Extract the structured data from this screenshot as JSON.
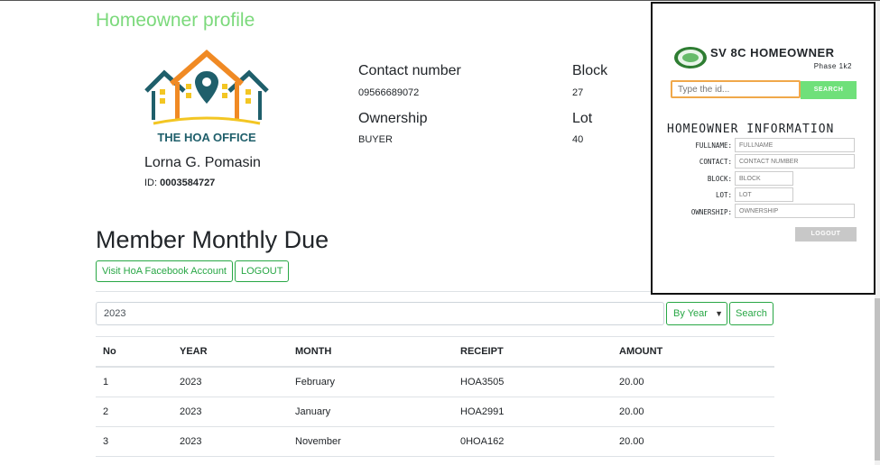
{
  "profile": {
    "title": "Homeowner profile",
    "logo_text": "THE HOA OFFICE",
    "name": "Lorna G. Pomasin",
    "id_label": "ID:",
    "id_value": "0003584727"
  },
  "info": {
    "contact_label": "Contact number",
    "contact_value": "09566689072",
    "ownership_label": "Ownership",
    "ownership_value": "BUYER",
    "block_label": "Block",
    "block_value": "27",
    "lot_label": "Lot",
    "lot_value": "40"
  },
  "dues": {
    "title": "Member Monthly Due",
    "facebook_button": "Visit HoA Facebook Account",
    "logout_button": "LOGOUT",
    "search_value": "2023",
    "filter_selected": "By Year",
    "search_button": "Search",
    "columns": [
      "No",
      "YEAR",
      "MONTH",
      "RECEIPT",
      "AMOUNT"
    ],
    "rows": [
      [
        "1",
        "2023",
        "February",
        "HOA3505",
        "20.00"
      ],
      [
        "2",
        "2023",
        "January",
        "HOA2991",
        "20.00"
      ],
      [
        "3",
        "2023",
        "November",
        "0HOA162",
        "20.00"
      ]
    ]
  },
  "panel": {
    "title": "SV 8C HOMEOWNER",
    "subtitle": "Phase 1k2",
    "id_placeholder": "Type the id...",
    "search_button": "SEARCH",
    "heading": "HOMEOWNER INFORMATION",
    "fields": [
      {
        "label": "FULLNAME:",
        "placeholder": "FULLNAME"
      },
      {
        "label": "CONTACT:",
        "placeholder": "CONTACT NUMBER"
      },
      {
        "label": "BLOCK:",
        "placeholder": "BLOCK"
      },
      {
        "label": "LOT:",
        "placeholder": "LOT"
      },
      {
        "label": "OWNERSHIP:",
        "placeholder": "OWNERSHIP"
      }
    ],
    "logout_button": "LOGOUT"
  },
  "colors": {
    "accent": "#28a745",
    "title_green": "#7bd97b",
    "logo_teal": "#1f5f6b",
    "logo_orange": "#f08a24",
    "logo_yellow": "#f3c623"
  }
}
